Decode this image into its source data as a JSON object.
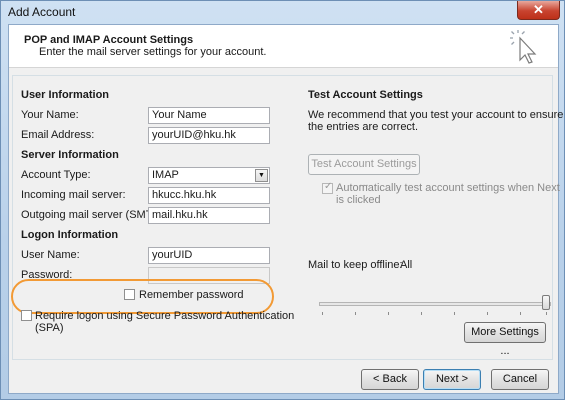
{
  "window": {
    "title": "Add Account",
    "close_glyph": "✕"
  },
  "header": {
    "title": "POP and IMAP Account Settings",
    "subtitle": "Enter the mail server settings for your account.",
    "icon": "cursor-click-icon"
  },
  "user_info": {
    "heading": "User Information",
    "your_name_label": "Your Name:",
    "your_name_value": "Your Name",
    "email_label": "Email Address:",
    "email_value": "yourUID@hku.hk"
  },
  "server_info": {
    "heading": "Server Information",
    "account_type_label": "Account Type:",
    "account_type_value": "IMAP",
    "incoming_label": "Incoming mail server:",
    "incoming_value": "hkucc.hku.hk",
    "outgoing_label": "Outgoing mail server (SMTP):",
    "outgoing_value": "mail.hku.hk"
  },
  "logon_info": {
    "heading": "Logon Information",
    "user_name_label": "User Name:",
    "user_name_value": "yourUID",
    "password_label": "Password:",
    "password_value": "",
    "remember_label": "Remember password",
    "remember_checked": false,
    "spa_label_line1": "Require logon using Secure Password Authentication",
    "spa_label_line2": "(SPA)",
    "spa_checked": false
  },
  "test": {
    "heading": "Test Account Settings",
    "description_line1": "We recommend that you test your account to ensure that",
    "description_line2": "the entries are correct.",
    "button_label": "Test Account Settings ...",
    "auto_test_line1": "Automatically test account settings when Next",
    "auto_test_line2": "is clicked",
    "auto_test_checked": true
  },
  "offline": {
    "label": "Mail to keep offline:",
    "value": "All",
    "slider_level": 1.0
  },
  "more_settings_label": "More Settings ...",
  "footer": {
    "back_label": "< Back",
    "next_label": "Next >",
    "cancel_label": "Cancel"
  },
  "colors": {
    "highlight_oval": "#f29a35",
    "title_bar": "#b9d1ea",
    "close_button": "#c8432f"
  }
}
